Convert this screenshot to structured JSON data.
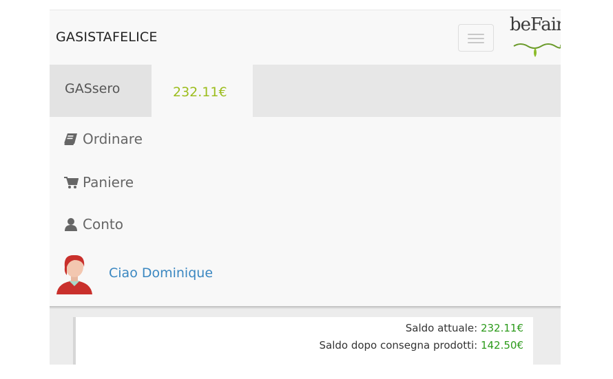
{
  "navbar": {
    "brand": "GASISTAFELICE",
    "logo_text": "beFair"
  },
  "user_tabs": {
    "user_label": "GASsero",
    "balance": "232.11€"
  },
  "menu": {
    "items": [
      {
        "label": "Ordinare",
        "icon": "book-icon"
      },
      {
        "label": "Paniere",
        "icon": "cart-icon"
      },
      {
        "label": "Conto",
        "icon": "user-icon"
      }
    ],
    "greeting": "Ciao Dominique"
  },
  "summary": {
    "current_label": "Saldo attuale:",
    "current_value": "232.11€",
    "after_label": "Saldo dopo consegna prodotti:",
    "after_value": "142.50€"
  },
  "colors": {
    "balance_accent": "#9cbd1d",
    "link": "#3a87c1",
    "positive": "#2b9a1a"
  }
}
